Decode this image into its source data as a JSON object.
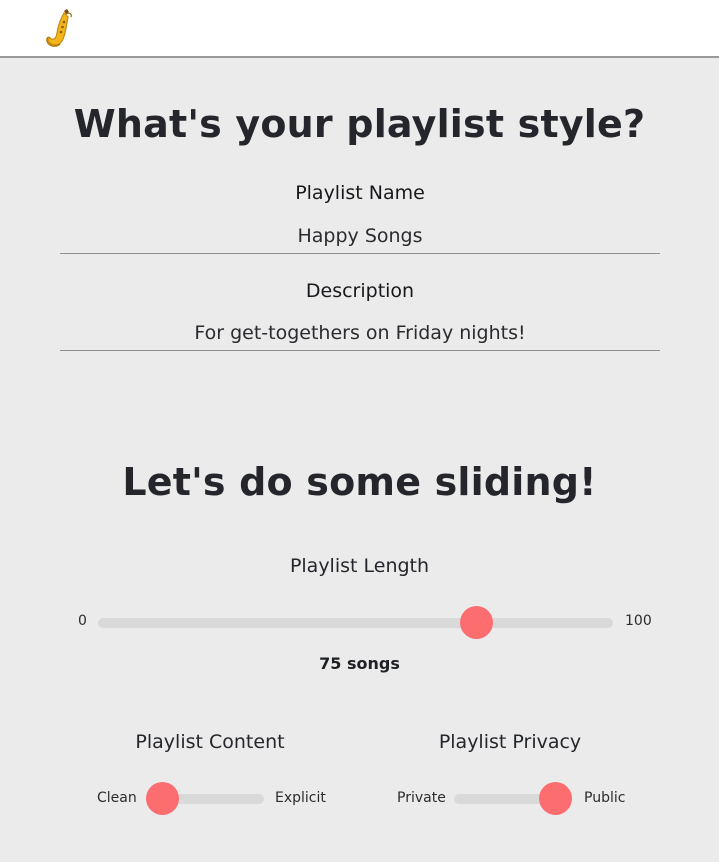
{
  "header": {
    "logo_icon": "saxophone-icon"
  },
  "style_section": {
    "title": "What's your playlist style?",
    "name_label": "Playlist Name",
    "name_value": "Happy Songs",
    "description_label": "Description",
    "description_value": "For get-togethers on Friday nights!"
  },
  "slider_section": {
    "title": "Let's do some sliding!",
    "length": {
      "label": "Playlist Length",
      "min_label": "0",
      "max_label": "100",
      "min": 0,
      "max": 100,
      "value": 75,
      "readout": "75 songs"
    },
    "content": {
      "label": "Playlist Content",
      "left_label": "Clean",
      "right_label": "Explicit",
      "value": 0
    },
    "privacy": {
      "label": "Playlist Privacy",
      "left_label": "Private",
      "right_label": "Public",
      "value": 1
    }
  },
  "colors": {
    "accent": "#fb6d6f",
    "track": "#d9d9d9",
    "background": "#ebebeb",
    "heading": "#24262b"
  }
}
